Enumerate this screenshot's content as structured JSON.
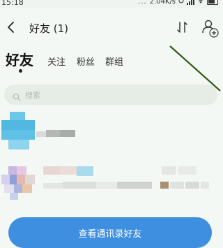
{
  "status_bar": {
    "time": "15:18",
    "net_speed": "2.04K/s",
    "dots": "..."
  },
  "header": {
    "title": "好友 (1)",
    "icons": [
      "back-icon",
      "sort-icon",
      "add-friend-icon"
    ]
  },
  "tabs": {
    "active": "好友",
    "items": [
      "关注",
      "粉丝",
      "群组"
    ]
  },
  "search": {
    "placeholder": "搜索"
  },
  "contacts_button": {
    "label": "查看通讯录好友"
  },
  "colors": {
    "accent": "#3f8fe0",
    "background": "#f4f8f4",
    "search_bg": "#e6ece6",
    "annotation": "#2f5a16"
  }
}
